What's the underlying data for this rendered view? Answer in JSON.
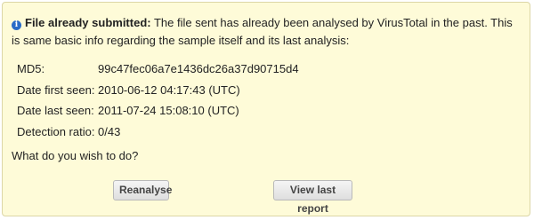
{
  "notice": {
    "title": "File already submitted:",
    "message": "The file sent has already been analysed by VirusTotal in the past. This is same basic info regarding the sample itself and its last analysis:"
  },
  "sample_info": [
    {
      "label": "MD5:",
      "value": "99c47fec06a7e1436dc26a37d90715d4"
    },
    {
      "label": "Date first seen:",
      "value": "2010-06-12 04:17:43 (UTC)"
    },
    {
      "label": "Date last seen:",
      "value": "2011-07-24 15:08:10 (UTC)"
    },
    {
      "label": "Detection ratio:",
      "value": "0/43"
    }
  ],
  "question": "What do you wish to do?",
  "actions": {
    "reanalyse_label": "Reanalyse",
    "view_report_label": "View last report"
  },
  "colors": {
    "panel_background": "#fefbd8",
    "info_icon": "#2a6cc7"
  },
  "icons": {
    "notice": "info-icon"
  }
}
